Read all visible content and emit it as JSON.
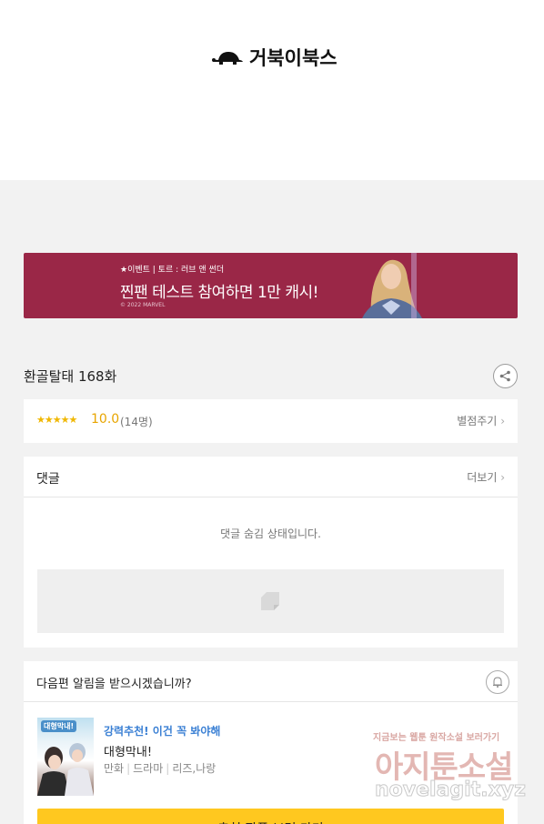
{
  "header": {
    "logo_text": "거북이북스",
    "logo_icon": "turtle-icon"
  },
  "banner": {
    "small": "★이벤트 | 토르 : 러브 앤 썬더",
    "main": "찐팬 테스트 참여하면 1만 캐시!",
    "copyright": "© 2022 MARVEL",
    "bg_color": "#9a2747"
  },
  "episode": {
    "title": "환골탈태 168화",
    "share_icon": "share-icon"
  },
  "rating": {
    "stars": "★★★★★",
    "score": "10.0",
    "count": "(14명)",
    "rate_label": "별점주기"
  },
  "comments": {
    "title": "댓글",
    "more_label": "더보기",
    "hidden_message": "댓글 숨김 상태입니다."
  },
  "next": {
    "prompt": "다음편 알림을 받으시겠습니까?",
    "bell_icon": "bell-icon",
    "recommend": {
      "tag": "강력추천! 이건 꼭 봐야해",
      "name": "대형막내!",
      "thumb_title": "대형막내!",
      "genres": [
        "만화",
        "드라마",
        "리즈,나랑"
      ]
    },
    "cta_label": "추천 작품 보러 가기"
  },
  "watermark": {
    "top": "지금보는 웹툰 원작소설 보러가기",
    "main": "아지툰소설",
    "url": "novelagit.xyz"
  }
}
